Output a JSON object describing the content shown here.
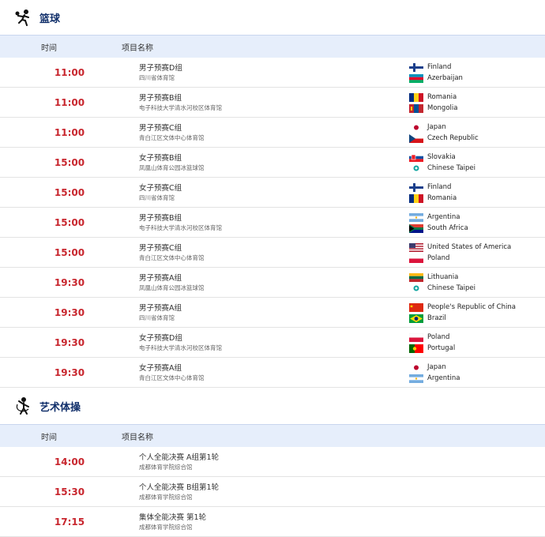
{
  "basketball": {
    "title": "篮球",
    "col_time": "时间",
    "col_name": "项目名称",
    "rows": [
      {
        "time": "11:00",
        "event": "男子预赛D组",
        "venue": "四川省体育馆",
        "team1": "Finland",
        "team2": "Azerbaijan"
      },
      {
        "time": "11:00",
        "event": "男子预赛B组",
        "venue": "电子科技大学清水河校区体育馆",
        "team1": "Romania",
        "team2": "Mongolia"
      },
      {
        "time": "11:00",
        "event": "男子预赛C组",
        "venue": "青白江区文体中心体育馆",
        "team1": "Japan",
        "team2": "Czech Republic"
      },
      {
        "time": "15:00",
        "event": "女子预赛B组",
        "venue": "凤凰山体育公园冰篮球馆",
        "team1": "Slovakia",
        "team2": "Chinese Taipei"
      },
      {
        "time": "15:00",
        "event": "女子预赛C组",
        "venue": "四川省体育馆",
        "team1": "Finland",
        "team2": "Romania"
      },
      {
        "time": "15:00",
        "event": "男子预赛B组",
        "venue": "电子科技大学清水河校区体育馆",
        "team1": "Argentina",
        "team2": "South Africa"
      },
      {
        "time": "15:00",
        "event": "男子预赛C组",
        "venue": "青白江区文体中心体育馆",
        "team1": "United States of America",
        "team2": "Poland"
      },
      {
        "time": "19:30",
        "event": "男子预赛A组",
        "venue": "凤凰山体育公园冰篮球馆",
        "team1": "Lithuania",
        "team2": "Chinese Taipei"
      },
      {
        "time": "19:30",
        "event": "男子预赛A组",
        "venue": "四川省体育馆",
        "team1": "People's Republic of China",
        "team2": "Brazil"
      },
      {
        "time": "19:30",
        "event": "女子预赛D组",
        "venue": "电子科技大学清水河校区体育馆",
        "team1": "Poland",
        "team2": "Portugal"
      },
      {
        "time": "19:30",
        "event": "女子预赛A组",
        "venue": "青白江区文体中心体育馆",
        "team1": "Japan",
        "team2": "Argentina"
      }
    ]
  },
  "gymnastics": {
    "title": "艺术体操",
    "col_time": "时间",
    "col_name": "项目名称",
    "rows": [
      {
        "time": "14:00",
        "event": "个人全能决赛 A组第1轮",
        "venue": "成都体育学院综合馆"
      },
      {
        "time": "15:30",
        "event": "个人全能决赛 B组第1轮",
        "venue": "成都体育学院综合馆"
      },
      {
        "time": "17:15",
        "event": "集体全能决赛 第1轮",
        "venue": "成都体育学院综合馆"
      }
    ]
  },
  "colors": {
    "time": "#c8262e",
    "title": "#12306b",
    "header_bg": "#e6eefb"
  }
}
